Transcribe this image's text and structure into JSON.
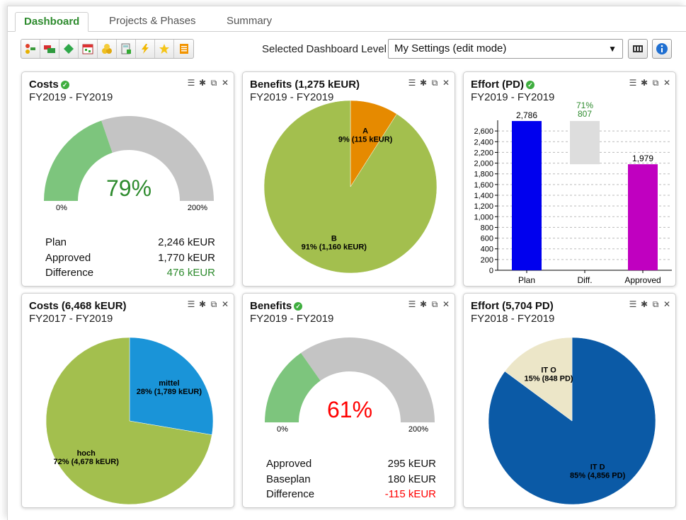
{
  "tabs": [
    "Dashboard",
    "Projects & Phases",
    "Summary"
  ],
  "toolbar": {
    "icons": [
      "structure-icon",
      "move-icon",
      "diamond-icon",
      "calendar-icon",
      "coins-icon",
      "calculator-icon",
      "lightning-icon",
      "star-icon",
      "report-icon"
    ],
    "level_label": "Selected Dashboard Level",
    "level_value": "My Settings (edit mode)"
  },
  "panels": {
    "costs_gauge": {
      "title": "Costs",
      "subtitle": "FY2019 - FY2019",
      "percent": "79%",
      "min": "0%",
      "max": "200%",
      "fill_fraction": 0.395,
      "rows": [
        {
          "k": "Plan",
          "v": "2,246 kEUR"
        },
        {
          "k": "Approved",
          "v": "1,770 kEUR"
        },
        {
          "k": "Difference",
          "v": "476 kEUR"
        }
      ]
    },
    "benefits_pie": {
      "title": "Benefits (1,275 kEUR)",
      "subtitle": "FY2019 - FY2019"
    },
    "effort_bar": {
      "title": "Effort (PD)",
      "subtitle": "FY2019 - FY2019"
    },
    "costs_pie": {
      "title": "Costs (6,468 kEUR)",
      "subtitle": "FY2017 - FY2019"
    },
    "benefits_gauge": {
      "title": "Benefits",
      "subtitle": "FY2019 - FY2019",
      "percent": "61%",
      "min": "0%",
      "max": "200%",
      "fill_fraction": 0.305,
      "rows": [
        {
          "k": "Approved",
          "v": "295 kEUR"
        },
        {
          "k": "Baseplan",
          "v": "180 kEUR"
        },
        {
          "k": "Difference",
          "v": "-115 kEUR"
        }
      ]
    },
    "effort_pie": {
      "title": "Effort (5,704 PD)",
      "subtitle": "FY2018 - FY2019"
    }
  },
  "chart_data": [
    {
      "type": "pie",
      "title": "Benefits (1,275 kEUR)",
      "slices": [
        {
          "name": "A",
          "label": "9% (115 kEUR)",
          "value": 115,
          "color": "#e68a00"
        },
        {
          "name": "B",
          "label": "91% (1,160 kEUR)",
          "value": 1160,
          "color": "#a3bf4e"
        }
      ]
    },
    {
      "type": "bar",
      "title": "Effort (PD)",
      "categories": [
        "Plan",
        "Diff.",
        "Approved"
      ],
      "values": [
        2786,
        807,
        1979
      ],
      "value_labels": [
        "2,786",
        "807",
        "1,979"
      ],
      "diff_percent": "71%",
      "colors": [
        "#0000ee",
        "#dddddd",
        "#c000c0"
      ],
      "ylim": [
        0,
        2800
      ],
      "yticks": [
        0,
        200,
        400,
        600,
        800,
        1000,
        1200,
        1400,
        1600,
        1800,
        2000,
        2200,
        2400,
        2600
      ],
      "ytick_labels": [
        "0",
        "200",
        "400",
        "600",
        "800",
        "1,000",
        "1,200",
        "1,400",
        "1,600",
        "1,800",
        "2,000",
        "2,200",
        "2,400",
        "2,600"
      ],
      "grid": true
    },
    {
      "type": "pie",
      "title": "Costs (6,468 kEUR)",
      "slices": [
        {
          "name": "mittel",
          "label": "28% (1,789 kEUR)",
          "value": 1789,
          "color": "#1a94d8"
        },
        {
          "name": "hoch",
          "label": "72% (4,678 kEUR)",
          "value": 4678,
          "color": "#a3bf4e"
        }
      ]
    },
    {
      "type": "pie",
      "title": "Effort (5,704 PD)",
      "slices": [
        {
          "name": "IT D",
          "label": "85% (4,856 PD)",
          "value": 4856,
          "color": "#0b5aa6"
        },
        {
          "name": "IT O",
          "label": "15% (848 PD)",
          "value": 848,
          "color": "#ece6c8"
        }
      ]
    }
  ],
  "colors": {
    "accent": "#2e8b2e",
    "gauge_fill": "#7dc57d",
    "gauge_rest": "#c4c4c4",
    "positive": "#2e8b2e",
    "negative": "#ff0000"
  }
}
